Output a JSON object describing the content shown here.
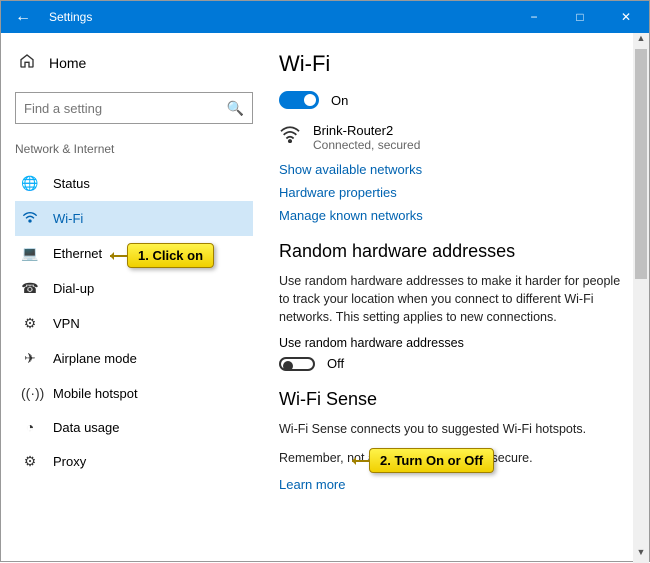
{
  "titlebar": {
    "title": "Settings"
  },
  "sidebar": {
    "home": "Home",
    "search_placeholder": "Find a setting",
    "section": "Network & Internet",
    "items": [
      {
        "label": "Status"
      },
      {
        "label": "Wi-Fi"
      },
      {
        "label": "Ethernet"
      },
      {
        "label": "Dial-up"
      },
      {
        "label": "VPN"
      },
      {
        "label": "Airplane mode"
      },
      {
        "label": "Mobile hotspot"
      },
      {
        "label": "Data usage"
      },
      {
        "label": "Proxy"
      }
    ]
  },
  "content": {
    "h1": "Wi-Fi",
    "wifi_toggle_label": "On",
    "network": {
      "name": "Brink-Router2",
      "status": "Connected, secured"
    },
    "links": {
      "show_networks": "Show available networks",
      "hardware_props": "Hardware properties",
      "manage_networks": "Manage known networks"
    },
    "random": {
      "heading": "Random hardware addresses",
      "desc": "Use random hardware addresses to make it harder for people to track your location when you connect to different Wi-Fi networks. This setting applies to new connections.",
      "toggle_label": "Use random hardware addresses",
      "toggle_state": "Off"
    },
    "sense": {
      "heading": "Wi-Fi Sense",
      "line1": "Wi-Fi Sense connects you to suggested Wi-Fi hotspots.",
      "line2": "Remember, not all Wi-Fi networks are secure.",
      "learn": "Learn more"
    }
  },
  "callouts": {
    "c1": "1. Click on",
    "c2": "2. Turn On or Off"
  }
}
